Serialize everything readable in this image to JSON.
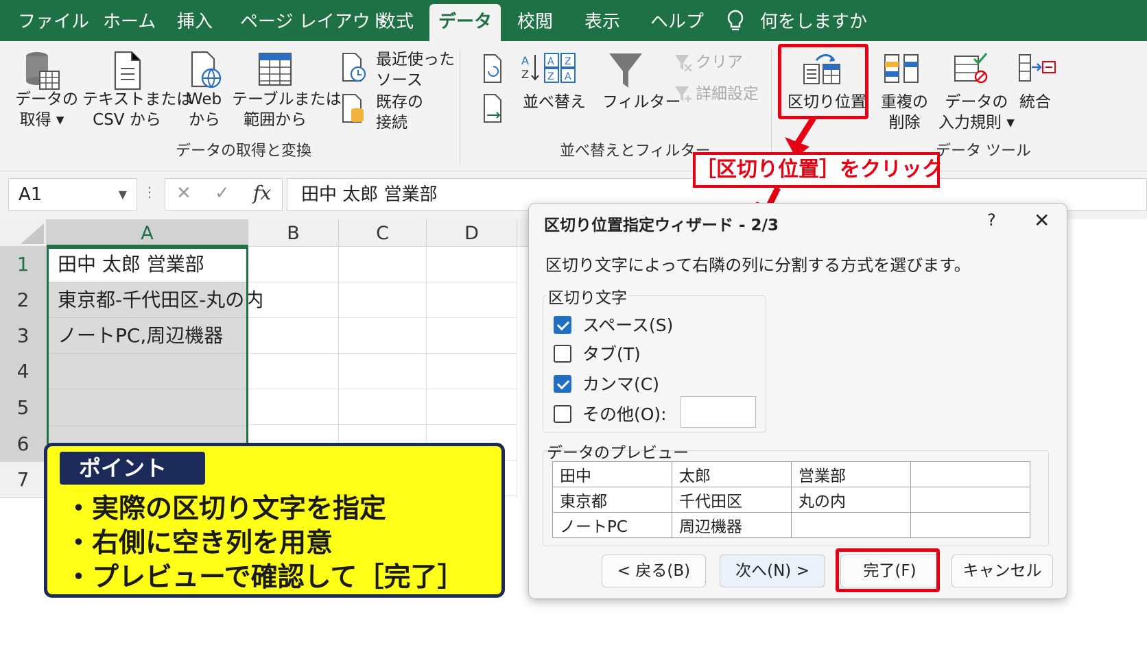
{
  "ribbon_tabs": [
    "ファイル",
    "ホーム",
    "挿入",
    "ページ レイアウト",
    "数式",
    "データ",
    "校閲",
    "表示",
    "ヘルプ"
  ],
  "active_tab": "データ",
  "tell_me": "何をしますか",
  "ribbon": {
    "get_data": [
      "データの",
      "取得 ▾"
    ],
    "text_csv": [
      "テキストまたは",
      "CSV から"
    ],
    "web": [
      "Web",
      "から"
    ],
    "table_range": [
      "テーブルまたは",
      "範囲から"
    ],
    "recent_sources": [
      "最近使った",
      "ソース"
    ],
    "existing_conn": [
      "既存の",
      "接続"
    ],
    "group_get": "データの取得と変換",
    "sort": "並べ替え",
    "filter": "フィルター",
    "clear": "クリア",
    "advanced": "詳細設定",
    "group_sort": "並べ替えとフィルター",
    "text_to_columns": "区切り位置",
    "remove_dup": [
      "重複の",
      "削除"
    ],
    "validation": [
      "データの",
      "入力規則 ▾"
    ],
    "consolidate": "統合",
    "group_tools": "データ ツール"
  },
  "formula_bar": {
    "name_box": "A1",
    "cancel": "✕",
    "enter": "✓",
    "fx": "fx",
    "formula": "田中 太郎 営業部"
  },
  "sheet": {
    "columns": [
      "A",
      "B",
      "C",
      "D"
    ],
    "rows": [
      "1",
      "2",
      "3",
      "4",
      "5",
      "6",
      "7"
    ],
    "cells": [
      "田中 太郎 営業部",
      "東京都-千代田区-丸の内",
      "ノートPC,周辺機器"
    ]
  },
  "callout": "［区切り位置］をクリック",
  "dialog": {
    "title": "区切り位置指定ウィザード - 2/3",
    "help": "?",
    "close": "✕",
    "description": "区切り文字によって右隣の列に分割する方式を選びます。",
    "delimiters_label": "区切り文字",
    "delimiters": [
      {
        "label": "スペース(S)",
        "checked": true
      },
      {
        "label": "タブ(T)",
        "checked": false
      },
      {
        "label": "カンマ(C)",
        "checked": true
      },
      {
        "label": "その他(O):",
        "checked": false
      }
    ],
    "preview_label": "データのプレビュー",
    "preview_rows": [
      [
        "田中",
        "太郎",
        "営業部",
        ""
      ],
      [
        "東京都",
        "千代田区",
        "丸の内",
        ""
      ],
      [
        "ノートPC",
        "周辺機器",
        "",
        ""
      ]
    ],
    "buttons": {
      "back": "< 戻る(B)",
      "next": "次へ(N) >",
      "finish": "完了(F)",
      "cancel": "キャンセル"
    }
  },
  "point_box": {
    "title": "ポイント",
    "lines": [
      "・実際の区切り文字を指定",
      "・右側に空き列を用意",
      "・プレビューで確認して［完了］"
    ]
  },
  "colors": {
    "excel_green": "#1e7145",
    "annotation_red": "#e60012",
    "point_yellow": "#ffff17",
    "point_navy": "#1b2a58",
    "checkbox_blue": "#1f6fc5"
  }
}
